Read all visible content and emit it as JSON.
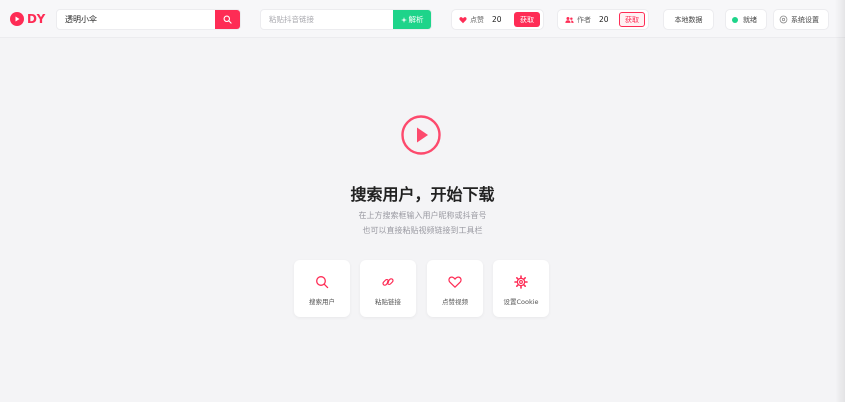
{
  "header": {
    "logo_text": "DY",
    "search": {
      "value": "透明小伞"
    },
    "link": {
      "placeholder": "粘贴抖音链接",
      "parse_label": "解析"
    },
    "like": {
      "label": "点赞",
      "count": "20",
      "fetch_label": "获取"
    },
    "author": {
      "label": "作者",
      "count": "20",
      "fetch_label": "获取"
    },
    "local_data_label": "本地数据",
    "status_label": "就绪",
    "settings_label": "系统设置"
  },
  "main": {
    "title": "搜索用户，开始下载",
    "subtitle_1": "在上方搜索框输入用户昵称或抖音号",
    "subtitle_2": "也可以直接粘贴视频链接到工具栏",
    "quick_actions": [
      {
        "label": "搜索用户",
        "icon": "search-icon"
      },
      {
        "label": "粘贴链接",
        "icon": "link-icon"
      },
      {
        "label": "点赞视频",
        "icon": "heart-icon"
      },
      {
        "label": "设置Cookie",
        "icon": "gear-icon"
      }
    ]
  },
  "colors": {
    "accent": "#fe2c55",
    "success": "#1ed48a"
  }
}
